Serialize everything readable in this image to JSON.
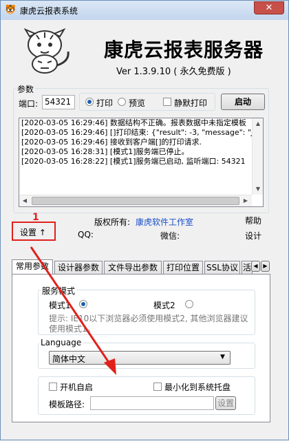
{
  "window": {
    "title": "康虎云报表系统",
    "close_label": "✕"
  },
  "header": {
    "app_name": "康虎云报表服务器",
    "version": "Ver 1.3.9.10 ( 永久免费版 )"
  },
  "params": {
    "group_label": "参数",
    "port_label": "端口:",
    "port_value": "54321",
    "print_label": "打印",
    "preview_label": "预览",
    "silent_print_label": "静默打印",
    "start_label": "启动"
  },
  "log": {
    "lines": [
      "[2020-03-05 16:29:46] 数据结构不正确。报表数据中未指定模板",
      "[2020-03-05 16:29:46] []打印结束: {\"result\": -3, \"message\": \"Json内",
      "[2020-03-05 16:29:46] 接收到客户端[]的打印请求.",
      "[2020-03-05 16:28:31] [模式1]服务端已停止。",
      "[2020-03-05 16:28:22] [模式1]服务端已启动, 监听端口: 54321"
    ]
  },
  "info": {
    "settings_label": "设置 ↑",
    "copyright_label": "版权所有:",
    "copyright_link": "康虎软件工作室",
    "help_label": "帮助",
    "qq_label": "QQ:",
    "wechat_label": "微信:",
    "design_label": "设计",
    "annotation_number": "1"
  },
  "tabs": [
    {
      "label": "常用参数"
    },
    {
      "label": "设计器参数"
    },
    {
      "label": "文件导出参数"
    },
    {
      "label": "打印位置"
    },
    {
      "label": "SSL协议"
    },
    {
      "label": "活"
    }
  ],
  "service_mode": {
    "group_label": "服务模式",
    "mode1_label": "模式1",
    "mode2_label": "模式2",
    "hint": "提示: IE10以下浏览器必须使用模式2, 其他浏览器建议使用模式1。"
  },
  "language": {
    "group_label": "Language",
    "selected": "简体中文"
  },
  "startup": {
    "autostart_label": "开机自启",
    "minimize_tray_label": "最小化到系统托盘",
    "template_path_label": "模板路径:",
    "template_path_value": "",
    "path_button_label": "设置"
  },
  "colors": {
    "annotation_red": "#e0201b",
    "link_blue": "#1a4ec7"
  }
}
